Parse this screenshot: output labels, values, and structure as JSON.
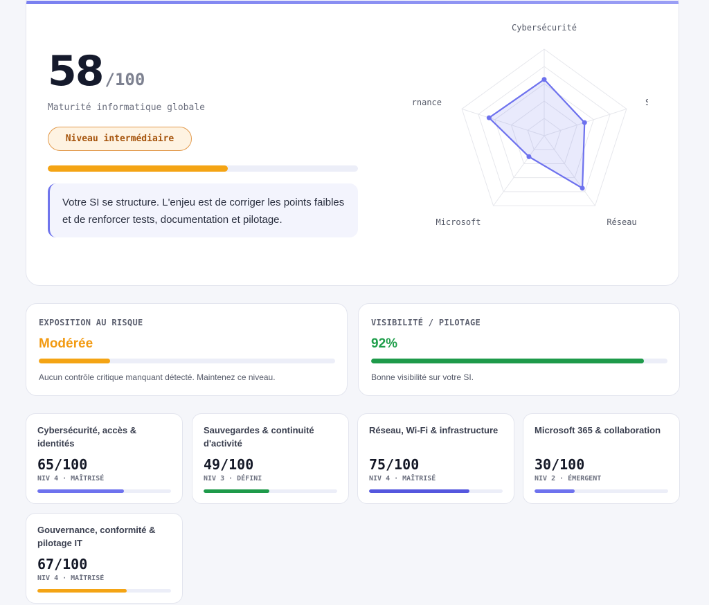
{
  "summary": {
    "score": "58",
    "score_denominator": "/100",
    "subtitle": "Maturité informatique globale",
    "level_badge": "Niveau intermédiaire",
    "progress": 0.58,
    "progress_color": "#f4a414",
    "message": "Votre SI se structure. L'enjeu est de corriger les points faibles et de renforcer tests, documentation et pilotage."
  },
  "chart_data": {
    "type": "radar",
    "axes": [
      "Cybersécurité",
      "Sauvegardes",
      "Réseau",
      "Microsoft",
      "Gouvernance"
    ],
    "axis_labels_visible": [
      "Cybersécurité",
      "Sauve|",
      "Réseau",
      "Microsoft",
      "rnance"
    ],
    "values": [
      65,
      49,
      75,
      30,
      67
    ],
    "max": 100,
    "grid_levels": 5,
    "color": "#6d71ee"
  },
  "risk": {
    "label": "EXPOSITION AU RISQUE",
    "value": "Modérée",
    "value_color": "#f29a12",
    "progress": 0.24,
    "progress_color": "#f4a414",
    "note": "Aucun contrôle critique manquant détecté. Maintenez ce niveau."
  },
  "visibility": {
    "label": "VISIBILITÉ / PILOTAGE",
    "value": "92%",
    "value_color": "#1f9e4b",
    "progress": 0.92,
    "progress_color": "#1e9a4a",
    "note": "Bonne visibilité sur votre SI."
  },
  "domains": [
    {
      "title": "Cybersécurité, accès & identités",
      "score": "65/100",
      "level": "NIV 4 · MAÎTRISÉ",
      "progress": 0.65,
      "color": "#6e72ee"
    },
    {
      "title": "Sauvegardes & continuité d'activité",
      "score": "49/100",
      "level": "NIV 3 · DÉFINI",
      "progress": 0.49,
      "color": "#1e9a4a"
    },
    {
      "title": "Réseau, Wi-Fi & infrastructure",
      "score": "75/100",
      "level": "NIV 4 · MAÎTRISÉ",
      "progress": 0.75,
      "color": "#5557de"
    },
    {
      "title": "Microsoft 365 & collaboration",
      "score": "30/100",
      "level": "NIV 2 · ÉMERGENT",
      "progress": 0.3,
      "color": "#6e72ee"
    },
    {
      "title": "Gouvernance, conformité & pilotage IT",
      "score": "67/100",
      "level": "NIV 4 · MAÎTRISÉ",
      "progress": 0.67,
      "color": "#f4a414"
    }
  ]
}
